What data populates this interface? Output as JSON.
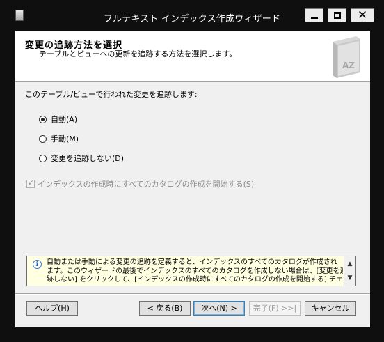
{
  "window": {
    "title": "フルテキスト インデックス作成ウィザード",
    "close_glyph": "✕"
  },
  "header": {
    "title": "変更の追跡方法を選択",
    "subtitle": "テーブルとビューへの更新を追跡する方法を選択します。",
    "book_text": "AZ"
  },
  "main": {
    "prompt": "このテーブル/ビューで行われた変更を追跡します:",
    "options": [
      {
        "label": "自動(A)",
        "checked": true
      },
      {
        "label": "手動(M)",
        "checked": false
      },
      {
        "label": "変更を追跡しない(D)",
        "checked": false
      }
    ],
    "start_population_label": "インデックスの作成時にすべてのカタログの作成を開始する(S)",
    "start_population_checked": true,
    "check_glyph": "✓"
  },
  "info": {
    "icon_glyph": "i",
    "lines": [
      "自動または手動による変更の追跡を定義すると、インデックスのすべてのカタログが作成され",
      "ます。このウィザードの最後でインデックスのすべてのカタログを作成しない場合は、[変更を追",
      "跡しない] をクリックして、[インデックスの作成時にすべてのカタログの作成を開始する] チェック"
    ],
    "scroll_up": "▲",
    "scroll_down": "▼"
  },
  "buttons": {
    "help": "ヘルプ(H)",
    "back": "< 戻る(B)",
    "next": "次へ(N) >",
    "finish": "完了(F) >>|",
    "cancel": "キャンセル"
  }
}
